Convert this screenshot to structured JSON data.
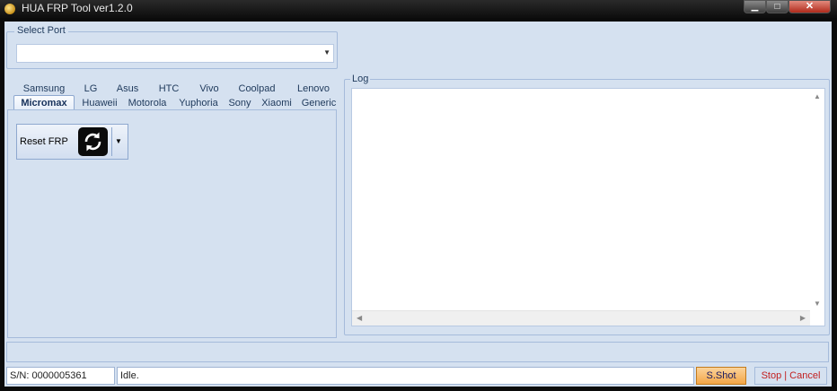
{
  "window": {
    "title": "HUA FRP Tool ver1.2.0",
    "controls": {
      "minimize": "▁",
      "maximize": "□",
      "close": "✕"
    }
  },
  "port": {
    "legend": "Select Port",
    "value": ""
  },
  "tabs": {
    "row1": [
      "Samsung",
      "LG",
      "Asus",
      "HTC",
      "Vivo",
      "Coolpad",
      "Lenovo"
    ],
    "row2": [
      "Micromax",
      "Huaweii",
      "Motorola",
      "Yuphoria",
      "Sony",
      "Xiaomi",
      "Generic"
    ],
    "active": "Micromax"
  },
  "actions": {
    "reset_frp_label": "Reset FRP"
  },
  "log": {
    "legend": "Log",
    "content": ""
  },
  "status": {
    "serial": "S/N: 0000005361",
    "message": "Idle.",
    "shot_label": "S.Shot",
    "stop_label": "Stop | Cancel"
  },
  "colors": {
    "panel_bg": "#d5e1f0",
    "accent_orange": "#f3a647",
    "stop_red": "#c22020"
  }
}
